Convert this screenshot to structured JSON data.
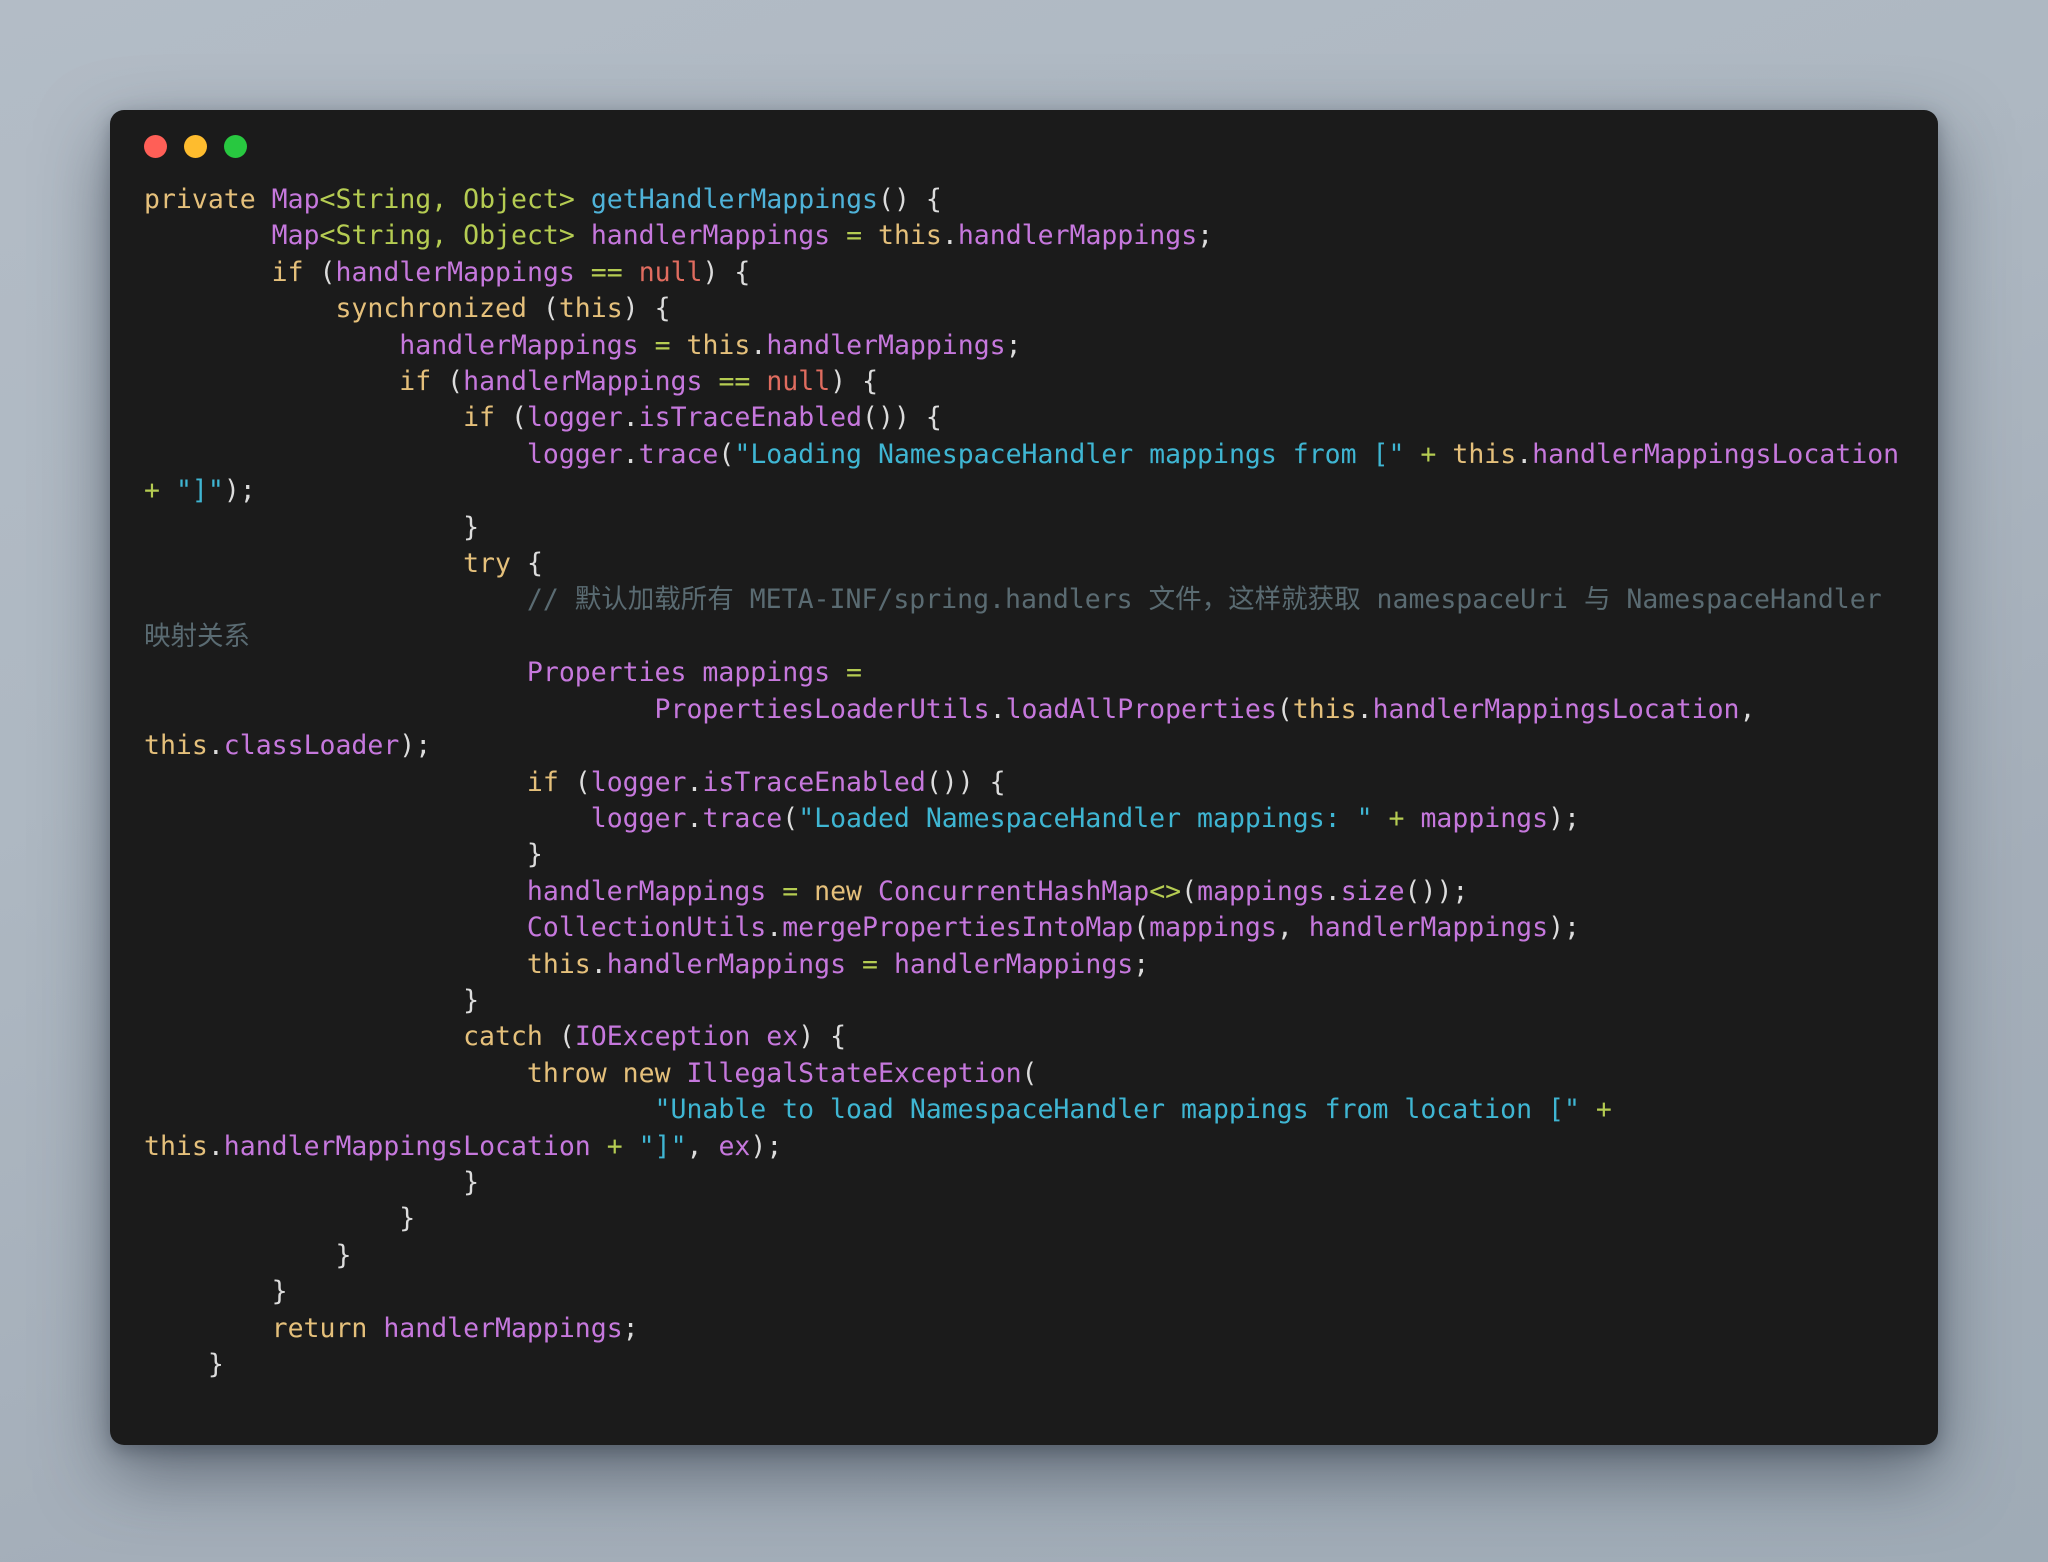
{
  "window": {
    "traffic_lights": [
      {
        "name": "close",
        "color": "#ff5f57"
      },
      {
        "name": "minimize",
        "color": "#febc2e"
      },
      {
        "name": "maximize",
        "color": "#28c840"
      }
    ],
    "background_color": "#1b1b1b",
    "page_background": "#aeb8c2"
  },
  "editor": {
    "language": "java",
    "theme_colors": {
      "keyword": "#e5c07b",
      "type": "#c678dd",
      "generic": "#b5cc52",
      "function": "#4fb3d9",
      "variable": "#c678dd",
      "string": "#3fb6d3",
      "null": "#e06c5f",
      "operator": "#b5cc52",
      "punctuation": "#dcdcdc",
      "comment": "#5a6b72"
    },
    "plain_text": "private Map<String, Object> getHandlerMappings() {\n        Map<String, Object> handlerMappings = this.handlerMappings;\n        if (handlerMappings == null) {\n            synchronized (this) {\n                handlerMappings = this.handlerMappings;\n                if (handlerMappings == null) {\n                    if (logger.isTraceEnabled()) {\n                        logger.trace(\"Loading NamespaceHandler mappings from [\" + this.handlerMappingsLocation + \"]\");\n                    }\n                    try {\n                        // 默认加载所有 META-INF/spring.handlers 文件，这样就获取 namespaceUri 与 NamespaceHandler 映射关系\n                        Properties mappings =\n                                PropertiesLoaderUtils.loadAllProperties(this.handlerMappingsLocation, this.classLoader);\n                        if (logger.isTraceEnabled()) {\n                            logger.trace(\"Loaded NamespaceHandler mappings: \" + mappings);\n                        }\n                        handlerMappings = new ConcurrentHashMap<>(mappings.size());\n                        CollectionUtils.mergePropertiesIntoMap(mappings, handlerMappings);\n                        this.handlerMappings = handlerMappings;\n                    }\n                    catch (IOException ex) {\n                        throw new IllegalStateException(\n                                \"Unable to load NamespaceHandler mappings from location [\" + this.handlerMappingsLocation + \"]\", ex);\n                    }\n                }\n            }\n        }\n        return handlerMappings;\n    }",
    "lines": [
      [
        {
          "t": "kw",
          "s": "private"
        },
        {
          "t": "plain",
          "s": " "
        },
        {
          "t": "type",
          "s": "Map"
        },
        {
          "t": "gen",
          "s": "<"
        },
        {
          "t": "gen",
          "s": "String"
        },
        {
          "t": "gen",
          "s": ", "
        },
        {
          "t": "gen",
          "s": "Object"
        },
        {
          "t": "gen",
          "s": ">"
        },
        {
          "t": "plain",
          "s": " "
        },
        {
          "t": "fn",
          "s": "getHandlerMappings"
        },
        {
          "t": "punct",
          "s": "() {"
        }
      ],
      [
        {
          "t": "plain",
          "s": "        "
        },
        {
          "t": "type",
          "s": "Map"
        },
        {
          "t": "gen",
          "s": "<"
        },
        {
          "t": "gen",
          "s": "String"
        },
        {
          "t": "gen",
          "s": ", "
        },
        {
          "t": "gen",
          "s": "Object"
        },
        {
          "t": "gen",
          "s": ">"
        },
        {
          "t": "plain",
          "s": " "
        },
        {
          "t": "var",
          "s": "handlerMappings"
        },
        {
          "t": "plain",
          "s": " "
        },
        {
          "t": "op",
          "s": "="
        },
        {
          "t": "plain",
          "s": " "
        },
        {
          "t": "this",
          "s": "this"
        },
        {
          "t": "punct",
          "s": "."
        },
        {
          "t": "var",
          "s": "handlerMappings"
        },
        {
          "t": "punct",
          "s": ";"
        }
      ],
      [
        {
          "t": "plain",
          "s": "        "
        },
        {
          "t": "kw",
          "s": "if"
        },
        {
          "t": "plain",
          "s": " "
        },
        {
          "t": "punct",
          "s": "("
        },
        {
          "t": "var",
          "s": "handlerMappings"
        },
        {
          "t": "plain",
          "s": " "
        },
        {
          "t": "op",
          "s": "=="
        },
        {
          "t": "plain",
          "s": " "
        },
        {
          "t": "null",
          "s": "null"
        },
        {
          "t": "punct",
          "s": ") {"
        }
      ],
      [
        {
          "t": "plain",
          "s": "            "
        },
        {
          "t": "kw",
          "s": "synchronized"
        },
        {
          "t": "plain",
          "s": " "
        },
        {
          "t": "punct",
          "s": "("
        },
        {
          "t": "this",
          "s": "this"
        },
        {
          "t": "punct",
          "s": ") {"
        }
      ],
      [
        {
          "t": "plain",
          "s": "                "
        },
        {
          "t": "var",
          "s": "handlerMappings"
        },
        {
          "t": "plain",
          "s": " "
        },
        {
          "t": "op",
          "s": "="
        },
        {
          "t": "plain",
          "s": " "
        },
        {
          "t": "this",
          "s": "this"
        },
        {
          "t": "punct",
          "s": "."
        },
        {
          "t": "var",
          "s": "handlerMappings"
        },
        {
          "t": "punct",
          "s": ";"
        }
      ],
      [
        {
          "t": "plain",
          "s": "                "
        },
        {
          "t": "kw",
          "s": "if"
        },
        {
          "t": "plain",
          "s": " "
        },
        {
          "t": "punct",
          "s": "("
        },
        {
          "t": "var",
          "s": "handlerMappings"
        },
        {
          "t": "plain",
          "s": " "
        },
        {
          "t": "op",
          "s": "=="
        },
        {
          "t": "plain",
          "s": " "
        },
        {
          "t": "null",
          "s": "null"
        },
        {
          "t": "punct",
          "s": ") {"
        }
      ],
      [
        {
          "t": "plain",
          "s": "                    "
        },
        {
          "t": "kw",
          "s": "if"
        },
        {
          "t": "plain",
          "s": " "
        },
        {
          "t": "punct",
          "s": "("
        },
        {
          "t": "var",
          "s": "logger"
        },
        {
          "t": "punct",
          "s": "."
        },
        {
          "t": "var",
          "s": "isTraceEnabled"
        },
        {
          "t": "punct",
          "s": "()) {"
        }
      ],
      [
        {
          "t": "plain",
          "s": "                        "
        },
        {
          "t": "var",
          "s": "logger"
        },
        {
          "t": "punct",
          "s": "."
        },
        {
          "t": "var",
          "s": "trace"
        },
        {
          "t": "punct",
          "s": "("
        },
        {
          "t": "str",
          "s": "\"Loading NamespaceHandler mappings from [\""
        },
        {
          "t": "plain",
          "s": " "
        },
        {
          "t": "op",
          "s": "+"
        },
        {
          "t": "plain",
          "s": " "
        },
        {
          "t": "this",
          "s": "this"
        },
        {
          "t": "punct",
          "s": "."
        },
        {
          "t": "var",
          "s": "handlerMappingsLocation"
        },
        {
          "t": "plain",
          "s": " "
        },
        {
          "t": "op",
          "s": "+"
        },
        {
          "t": "plain",
          "s": " "
        },
        {
          "t": "str",
          "s": "\"]\""
        },
        {
          "t": "punct",
          "s": ");"
        }
      ],
      [
        {
          "t": "plain",
          "s": "                    "
        },
        {
          "t": "punct",
          "s": "}"
        }
      ],
      [
        {
          "t": "plain",
          "s": "                    "
        },
        {
          "t": "kw",
          "s": "try"
        },
        {
          "t": "plain",
          "s": " "
        },
        {
          "t": "punct",
          "s": "{"
        }
      ],
      [
        {
          "t": "plain",
          "s": "                        "
        },
        {
          "t": "comment",
          "s": "// 默认加载所有 META-INF/spring.handlers 文件，这样就获取 namespaceUri 与 NamespaceHandler 映射关系"
        }
      ],
      [
        {
          "t": "plain",
          "s": "                        "
        },
        {
          "t": "type",
          "s": "Properties"
        },
        {
          "t": "plain",
          "s": " "
        },
        {
          "t": "var",
          "s": "mappings"
        },
        {
          "t": "plain",
          "s": " "
        },
        {
          "t": "op",
          "s": "="
        }
      ],
      [
        {
          "t": "plain",
          "s": "                                "
        },
        {
          "t": "var",
          "s": "PropertiesLoaderUtils"
        },
        {
          "t": "punct",
          "s": "."
        },
        {
          "t": "var",
          "s": "loadAllProperties"
        },
        {
          "t": "punct",
          "s": "("
        },
        {
          "t": "this",
          "s": "this"
        },
        {
          "t": "punct",
          "s": "."
        },
        {
          "t": "var",
          "s": "handlerMappingsLocation"
        },
        {
          "t": "punct",
          "s": ", "
        },
        {
          "t": "this",
          "s": "this"
        },
        {
          "t": "punct",
          "s": "."
        },
        {
          "t": "var",
          "s": "classLoader"
        },
        {
          "t": "punct",
          "s": ");"
        }
      ],
      [
        {
          "t": "plain",
          "s": "                        "
        },
        {
          "t": "kw",
          "s": "if"
        },
        {
          "t": "plain",
          "s": " "
        },
        {
          "t": "punct",
          "s": "("
        },
        {
          "t": "var",
          "s": "logger"
        },
        {
          "t": "punct",
          "s": "."
        },
        {
          "t": "var",
          "s": "isTraceEnabled"
        },
        {
          "t": "punct",
          "s": "()) {"
        }
      ],
      [
        {
          "t": "plain",
          "s": "                            "
        },
        {
          "t": "var",
          "s": "logger"
        },
        {
          "t": "punct",
          "s": "."
        },
        {
          "t": "var",
          "s": "trace"
        },
        {
          "t": "punct",
          "s": "("
        },
        {
          "t": "str",
          "s": "\"Loaded NamespaceHandler mappings: \""
        },
        {
          "t": "plain",
          "s": " "
        },
        {
          "t": "op",
          "s": "+"
        },
        {
          "t": "plain",
          "s": " "
        },
        {
          "t": "var",
          "s": "mappings"
        },
        {
          "t": "punct",
          "s": ");"
        }
      ],
      [
        {
          "t": "plain",
          "s": "                        "
        },
        {
          "t": "punct",
          "s": "}"
        }
      ],
      [
        {
          "t": "plain",
          "s": "                        "
        },
        {
          "t": "var",
          "s": "handlerMappings"
        },
        {
          "t": "plain",
          "s": " "
        },
        {
          "t": "op",
          "s": "="
        },
        {
          "t": "plain",
          "s": " "
        },
        {
          "t": "kw",
          "s": "new"
        },
        {
          "t": "plain",
          "s": " "
        },
        {
          "t": "var",
          "s": "ConcurrentHashMap"
        },
        {
          "t": "gen",
          "s": "<>"
        },
        {
          "t": "punct",
          "s": "("
        },
        {
          "t": "var",
          "s": "mappings"
        },
        {
          "t": "punct",
          "s": "."
        },
        {
          "t": "var",
          "s": "size"
        },
        {
          "t": "punct",
          "s": "());"
        }
      ],
      [
        {
          "t": "plain",
          "s": "                        "
        },
        {
          "t": "var",
          "s": "CollectionUtils"
        },
        {
          "t": "punct",
          "s": "."
        },
        {
          "t": "var",
          "s": "mergePropertiesIntoMap"
        },
        {
          "t": "punct",
          "s": "("
        },
        {
          "t": "var",
          "s": "mappings"
        },
        {
          "t": "punct",
          "s": ", "
        },
        {
          "t": "var",
          "s": "handlerMappings"
        },
        {
          "t": "punct",
          "s": ");"
        }
      ],
      [
        {
          "t": "plain",
          "s": "                        "
        },
        {
          "t": "this",
          "s": "this"
        },
        {
          "t": "punct",
          "s": "."
        },
        {
          "t": "var",
          "s": "handlerMappings"
        },
        {
          "t": "plain",
          "s": " "
        },
        {
          "t": "op",
          "s": "="
        },
        {
          "t": "plain",
          "s": " "
        },
        {
          "t": "var",
          "s": "handlerMappings"
        },
        {
          "t": "punct",
          "s": ";"
        }
      ],
      [
        {
          "t": "plain",
          "s": "                    "
        },
        {
          "t": "punct",
          "s": "}"
        }
      ],
      [
        {
          "t": "plain",
          "s": "                    "
        },
        {
          "t": "kw",
          "s": "catch"
        },
        {
          "t": "plain",
          "s": " "
        },
        {
          "t": "punct",
          "s": "("
        },
        {
          "t": "type",
          "s": "IOException"
        },
        {
          "t": "plain",
          "s": " "
        },
        {
          "t": "var",
          "s": "ex"
        },
        {
          "t": "punct",
          "s": ") {"
        }
      ],
      [
        {
          "t": "plain",
          "s": "                        "
        },
        {
          "t": "kw",
          "s": "throw"
        },
        {
          "t": "plain",
          "s": " "
        },
        {
          "t": "kw",
          "s": "new"
        },
        {
          "t": "plain",
          "s": " "
        },
        {
          "t": "type",
          "s": "IllegalStateException"
        },
        {
          "t": "punct",
          "s": "("
        }
      ],
      [
        {
          "t": "plain",
          "s": "                                "
        },
        {
          "t": "str",
          "s": "\"Unable to load NamespaceHandler mappings from location [\""
        },
        {
          "t": "plain",
          "s": " "
        },
        {
          "t": "op",
          "s": "+"
        },
        {
          "t": "plain",
          "s": " "
        },
        {
          "t": "this",
          "s": "this"
        },
        {
          "t": "punct",
          "s": "."
        },
        {
          "t": "var",
          "s": "handlerMappingsLocation"
        },
        {
          "t": "plain",
          "s": " "
        },
        {
          "t": "op",
          "s": "+"
        },
        {
          "t": "plain",
          "s": " "
        },
        {
          "t": "str",
          "s": "\"]\""
        },
        {
          "t": "punct",
          "s": ", "
        },
        {
          "t": "var",
          "s": "ex"
        },
        {
          "t": "punct",
          "s": ");"
        }
      ],
      [
        {
          "t": "plain",
          "s": "                    "
        },
        {
          "t": "punct",
          "s": "}"
        }
      ],
      [
        {
          "t": "plain",
          "s": "                "
        },
        {
          "t": "punct",
          "s": "}"
        }
      ],
      [
        {
          "t": "plain",
          "s": "            "
        },
        {
          "t": "punct",
          "s": "}"
        }
      ],
      [
        {
          "t": "plain",
          "s": "        "
        },
        {
          "t": "punct",
          "s": "}"
        }
      ],
      [
        {
          "t": "plain",
          "s": "        "
        },
        {
          "t": "kw",
          "s": "return"
        },
        {
          "t": "plain",
          "s": " "
        },
        {
          "t": "var",
          "s": "handlerMappings"
        },
        {
          "t": "punct",
          "s": ";"
        }
      ],
      [
        {
          "t": "plain",
          "s": "    "
        },
        {
          "t": "punct",
          "s": "}"
        }
      ]
    ]
  }
}
